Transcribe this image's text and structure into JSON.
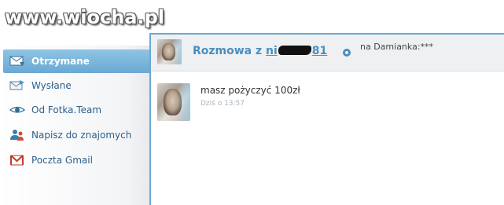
{
  "watermark": "www.wiocha.pl",
  "sidebar": {
    "items": [
      {
        "label": "Otrzymane",
        "icon": "inbox-icon",
        "active": true
      },
      {
        "label": "Wysłane",
        "icon": "sent-icon",
        "active": false
      },
      {
        "label": "Od Fotka.Team",
        "icon": "eye-icon",
        "active": false
      },
      {
        "label": "Napisz do znajomych",
        "icon": "friends-icon",
        "active": false
      },
      {
        "label": "Poczta Gmail",
        "icon": "gmail-icon",
        "active": false
      }
    ]
  },
  "conversation": {
    "title_prefix": "Rozmowa z",
    "nick_start": "ni",
    "nick_end": "81",
    "subtitle": "na Damianka:***"
  },
  "message": {
    "text": "masz pożyczyć 100zł",
    "time": "Dziś o 13:57"
  },
  "colors": {
    "accent": "#6aa9d3",
    "link": "#4a8fbf",
    "active_nav_bg": "#7bb7dc"
  }
}
